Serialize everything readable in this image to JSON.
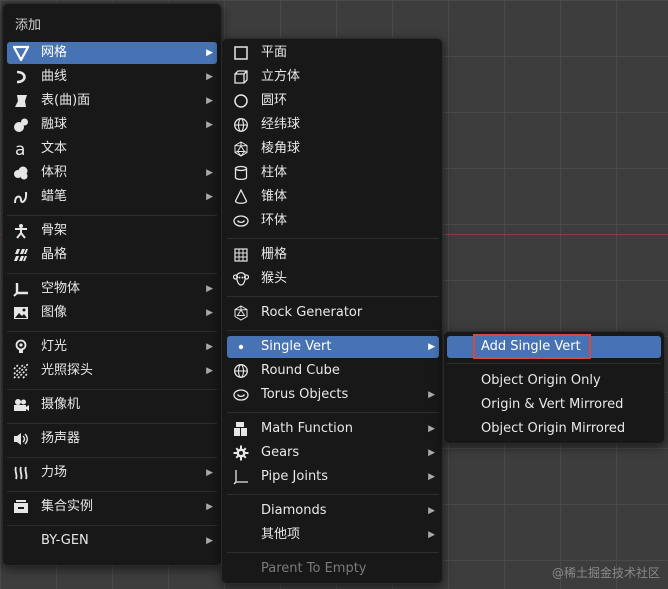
{
  "add_menu": {
    "title": "添加",
    "items": [
      {
        "label": "网格",
        "icon": "mesh-icon"
      },
      {
        "label": "曲线",
        "icon": "curve-icon"
      },
      {
        "label": "表(曲)面",
        "icon": "surface-icon"
      },
      {
        "label": "融球",
        "icon": "metaball-icon"
      },
      {
        "label": "文本",
        "icon": "text-icon"
      },
      {
        "label": "体积",
        "icon": "volume-icon"
      },
      {
        "label": "蜡笔",
        "icon": "grease-pencil-icon"
      },
      {
        "label": "骨架",
        "icon": "armature-icon"
      },
      {
        "label": "晶格",
        "icon": "lattice-icon"
      },
      {
        "label": "空物体",
        "icon": "empty-icon"
      },
      {
        "label": "图像",
        "icon": "image-icon"
      },
      {
        "label": "灯光",
        "icon": "light-icon"
      },
      {
        "label": "光照探头",
        "icon": "light-probe-icon"
      },
      {
        "label": "摄像机",
        "icon": "camera-icon"
      },
      {
        "label": "扬声器",
        "icon": "speaker-icon"
      },
      {
        "label": "力场",
        "icon": "force-field-icon"
      },
      {
        "label": "集合实例",
        "icon": "collection-instance-icon"
      },
      {
        "label": "BY-GEN",
        "icon": ""
      }
    ]
  },
  "mesh_menu": {
    "items": [
      {
        "label": "平面",
        "icon": "plane-icon"
      },
      {
        "label": "立方体",
        "icon": "cube-icon"
      },
      {
        "label": "圆环",
        "icon": "circle-icon"
      },
      {
        "label": "经纬球",
        "icon": "uv-sphere-icon"
      },
      {
        "label": "棱角球",
        "icon": "ico-sphere-icon"
      },
      {
        "label": "柱体",
        "icon": "cylinder-icon"
      },
      {
        "label": "锥体",
        "icon": "cone-icon"
      },
      {
        "label": "环体",
        "icon": "torus-icon"
      },
      {
        "label": "栅格",
        "icon": "grid-icon"
      },
      {
        "label": "猴头",
        "icon": "monkey-icon"
      },
      {
        "label": "Rock Generator",
        "icon": "ico-sphere-icon"
      },
      {
        "label": "Single Vert",
        "icon": "vertex-dot-icon"
      },
      {
        "label": "Round Cube",
        "icon": "uv-sphere-icon"
      },
      {
        "label": "Torus Objects",
        "icon": "torus-icon"
      },
      {
        "label": "Math Function",
        "icon": "blocks-icon"
      },
      {
        "label": "Gears",
        "icon": "gear-icon"
      },
      {
        "label": "Pipe Joints",
        "icon": "pipe-joint-icon"
      },
      {
        "label": "Diamonds",
        "icon": ""
      },
      {
        "label": "其他项",
        "icon": ""
      },
      {
        "label": "Parent To Empty",
        "icon": ""
      }
    ]
  },
  "vert_menu": {
    "items": [
      {
        "label": "Add Single Vert"
      },
      {
        "label": "Object Origin Only"
      },
      {
        "label": "Origin & Vert Mirrored"
      },
      {
        "label": "Object Origin Mirrored"
      }
    ]
  },
  "arrow_glyph": "▶",
  "watermark": "@稀土掘金技术社区",
  "colors": {
    "highlight": "#4772b3",
    "menu_bg": "#181818",
    "focus_box": "#d64a3a"
  }
}
